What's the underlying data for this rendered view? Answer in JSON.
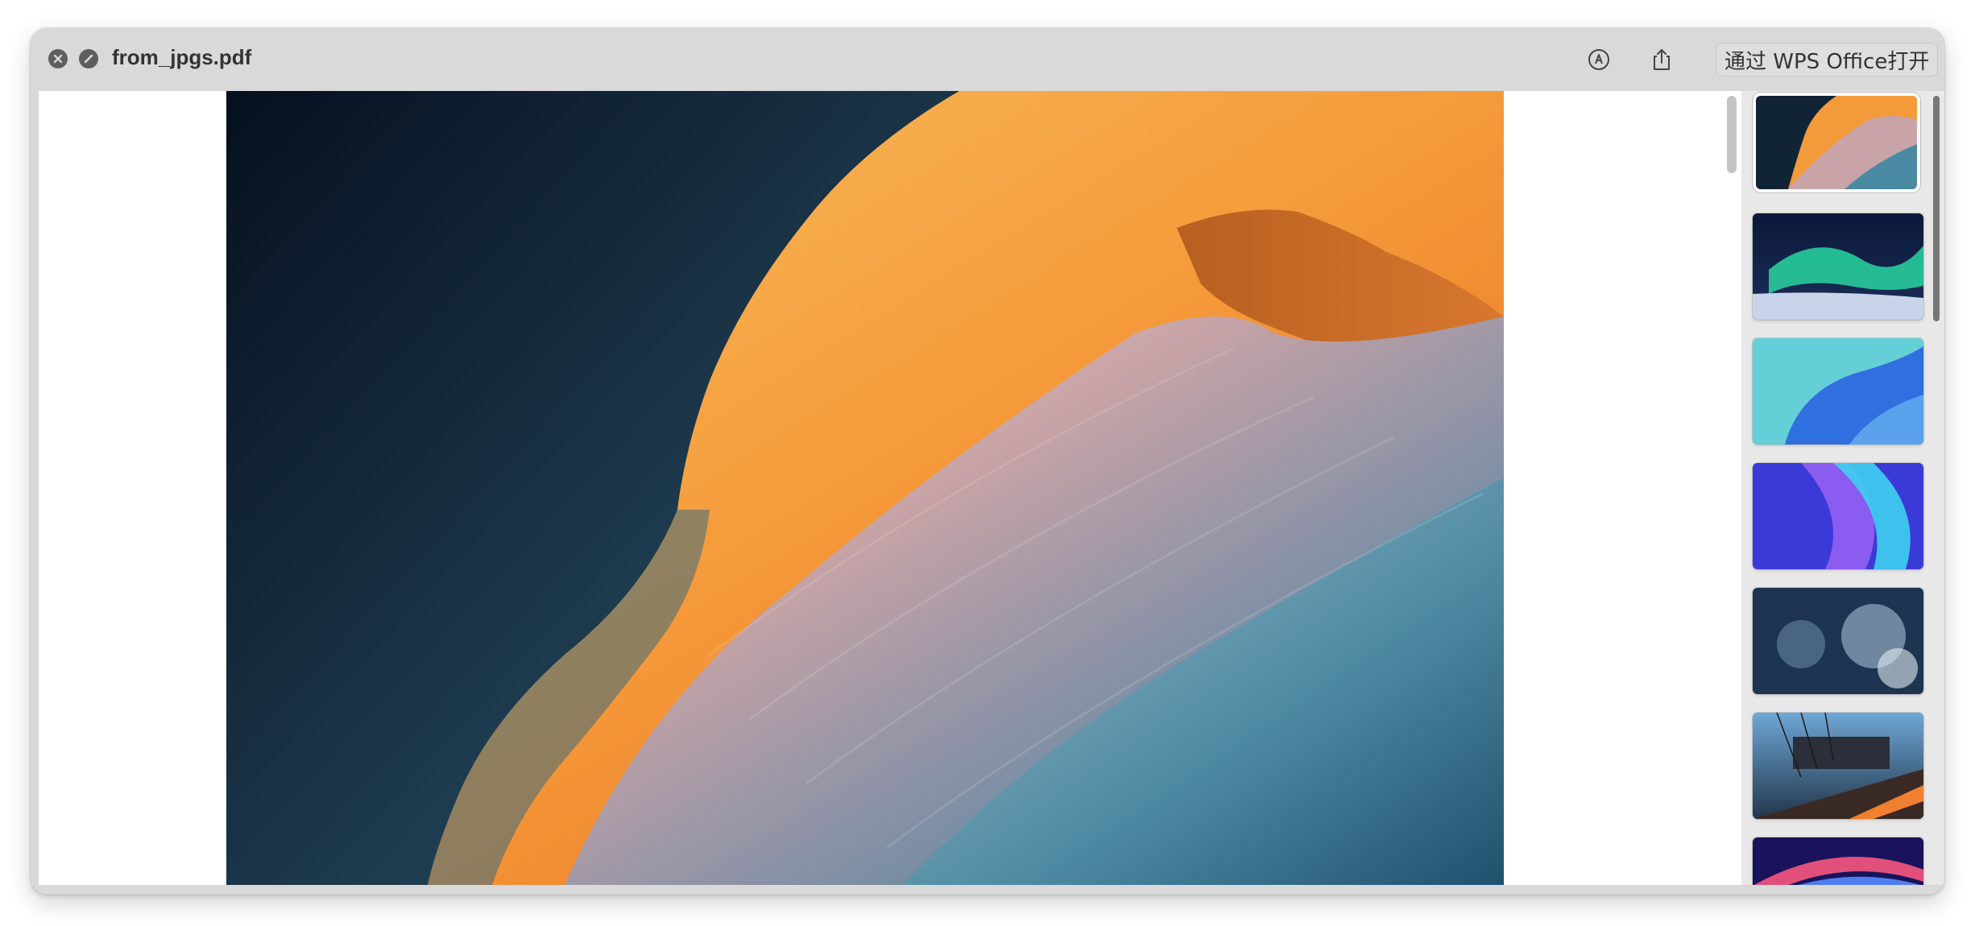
{
  "window": {
    "title": "from_jpgs.pdf"
  },
  "toolbar": {
    "markup_icon": "markup-icon",
    "share_icon": "share-icon",
    "open_with_label": "通过 WPS Office打开"
  },
  "document": {
    "current_page_image": "antelope-canyon-sandstone"
  },
  "thumbnails": [
    {
      "name": "antelope-canyon",
      "selected": true
    },
    {
      "name": "aurora-snow",
      "selected": false
    },
    {
      "name": "blue-abstract-waves",
      "selected": false
    },
    {
      "name": "purple-blue-swirl",
      "selected": false
    },
    {
      "name": "frosty-splash",
      "selected": false
    },
    {
      "name": "brooklyn-bridge-sunset",
      "selected": false
    },
    {
      "name": "blue-light-streak",
      "selected": false
    }
  ],
  "colors": {
    "window_bg": "#d9d9d9",
    "sidebar_bg": "#e8e8e8",
    "icon_gray": "#5e5e5e"
  }
}
